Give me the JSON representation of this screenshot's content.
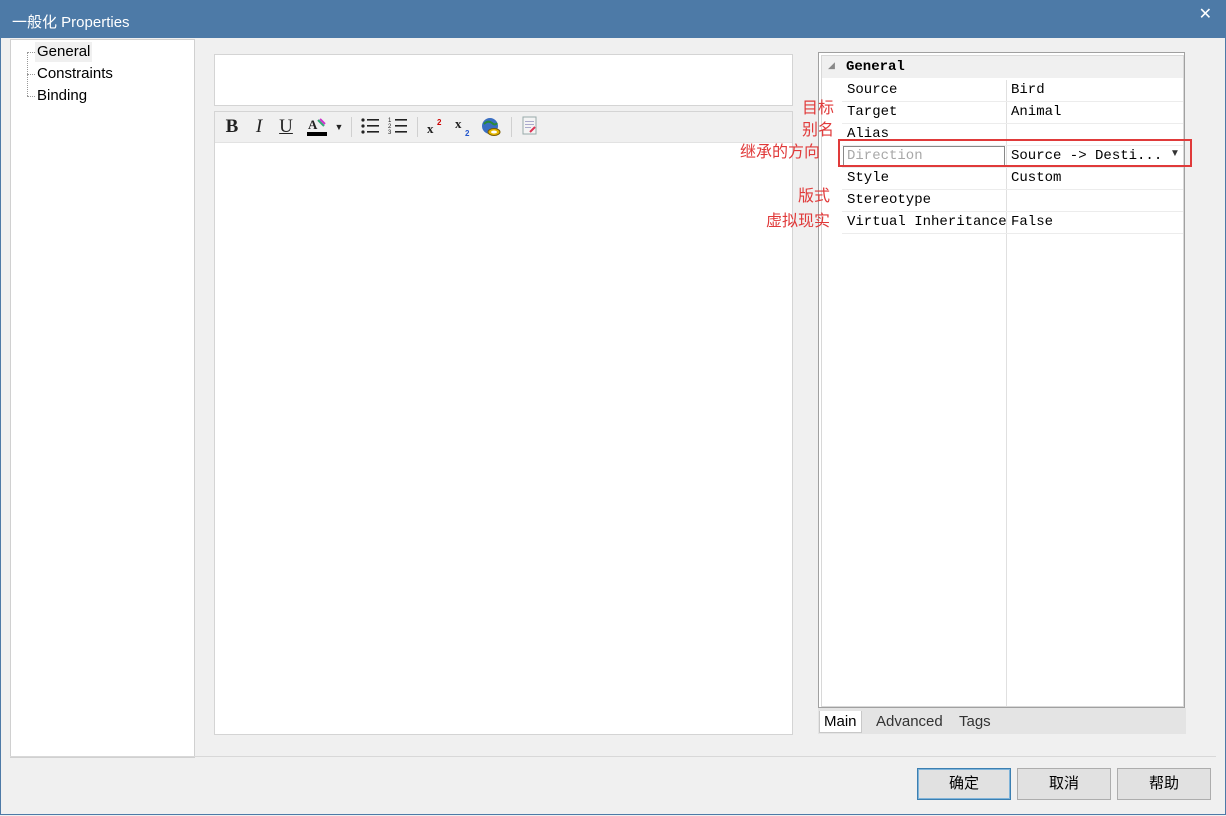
{
  "window": {
    "title": "一般化 Properties",
    "close_glyph": "✕"
  },
  "tree": {
    "items": [
      "General",
      "Constraints",
      "Binding"
    ],
    "selected": "General"
  },
  "toolbar": {
    "bold_icon": "B",
    "italic_icon": "I",
    "underline_icon": "U",
    "icons": [
      "bold-icon",
      "italic-icon",
      "underline-icon",
      "font-color-icon",
      "dropdown-arrow-icon",
      "bullet-list-icon",
      "numbered-list-icon",
      "superscript-icon",
      "subscript-icon",
      "hyperlink-icon",
      "document-icon"
    ]
  },
  "property_grid": {
    "section": "General",
    "rows": [
      {
        "name": "Source",
        "value": "Bird"
      },
      {
        "name": "Target",
        "value": "Animal"
      },
      {
        "name": "Alias",
        "value": ""
      },
      {
        "name": "Direction",
        "value": "Source -> Desti..."
      },
      {
        "name": "Style",
        "value": "Custom"
      },
      {
        "name": "Stereotype",
        "value": ""
      },
      {
        "name": "Virtual Inheritance",
        "value": "False"
      }
    ]
  },
  "annotations": {
    "target": "目标",
    "alias": "别名",
    "direction": "继承的方向",
    "stereotype": "版式",
    "virtual": "虚拟现实",
    "color": "#e03a3a"
  },
  "tabs": [
    "Main",
    "Advanced",
    "Tags"
  ],
  "buttons": {
    "ok": "确定",
    "cancel": "取消",
    "help": "帮助"
  },
  "colors": {
    "titlebar": "#4d7aa7",
    "highlight": "#e03a3a"
  }
}
